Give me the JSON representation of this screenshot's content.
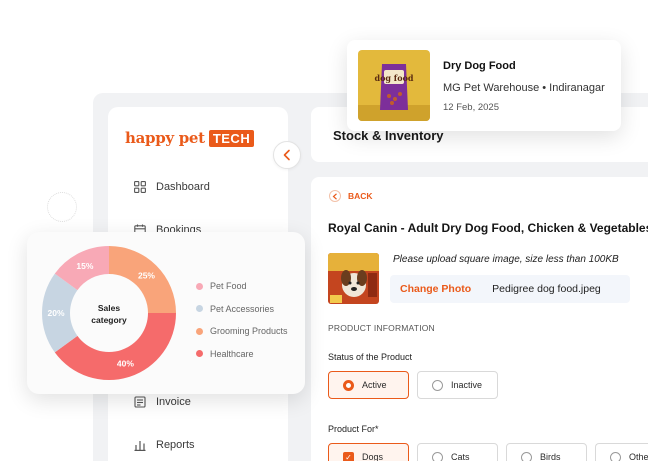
{
  "brand": {
    "name": "happy pet",
    "badge": "TECH"
  },
  "sidebar": {
    "items": [
      {
        "label": "Dashboard",
        "icon": "grid-icon"
      },
      {
        "label": "Bookings",
        "icon": "calendar-icon"
      },
      {
        "label": "Invoice",
        "icon": "invoice-icon"
      },
      {
        "label": "Reports",
        "icon": "bar-chart-icon"
      }
    ]
  },
  "header": {
    "title": "Stock & Inventory"
  },
  "notification": {
    "title": "Dry Dog Food",
    "subtitle": "MG Pet Warehouse • Indiranagar",
    "date": "12 Feb, 2025",
    "image_label": "dog food"
  },
  "form": {
    "back_label": "BACK",
    "product_title": "Royal Canin - Adult Dry Dog Food, Chicken & Vegetables",
    "upload_hint": "Please upload square image, size less than 100KB",
    "change_photo": "Change Photo",
    "file_name": "Pedigree dog food.jpeg",
    "section_label": "PRODUCT INFORMATION",
    "status": {
      "label": "Status of the Product",
      "options": [
        {
          "label": "Active",
          "selected": true
        },
        {
          "label": "Inactive",
          "selected": false
        }
      ]
    },
    "product_for": {
      "label": "Product For*",
      "options": [
        {
          "label": "Dogs",
          "selected": true
        },
        {
          "label": "Cats",
          "selected": false
        },
        {
          "label": "Birds",
          "selected": false
        },
        {
          "label": "Other",
          "selected": false
        }
      ]
    }
  },
  "chart_data": {
    "type": "pie",
    "title": "",
    "center_label": "Sales category",
    "categories": [
      "Pet Food",
      "Pet Accessories",
      "Grooming Products",
      "Healthcare"
    ],
    "values": [
      15,
      20,
      25,
      40
    ],
    "colors": [
      "#f8a9b6",
      "#c7d5e2",
      "#f9a47a",
      "#f56b6b"
    ],
    "legend": "right"
  },
  "colors": {
    "accent": "#ea5a1a",
    "background": "#f1f2f4"
  }
}
